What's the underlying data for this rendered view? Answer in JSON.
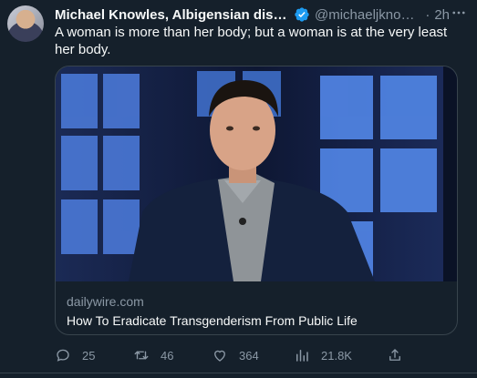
{
  "tweet": {
    "author_name": "Michael Knowles, Albigensian disresp...",
    "handle": "@michaeljknow...",
    "separator": "·",
    "time": "2h",
    "text": "A woman is more than her body; but a woman is at the very least her body.",
    "verified_color": "#1d9bf0"
  },
  "card": {
    "domain": "dailywire.com",
    "title": "How To Eradicate Transgenderism From Public Life"
  },
  "actions": {
    "replies": "25",
    "retweets": "46",
    "likes": "364",
    "views": "21.8K"
  },
  "icons": [
    "more-icon",
    "verified-badge-icon",
    "reply-icon",
    "retweet-icon",
    "like-icon",
    "views-icon",
    "share-icon"
  ]
}
